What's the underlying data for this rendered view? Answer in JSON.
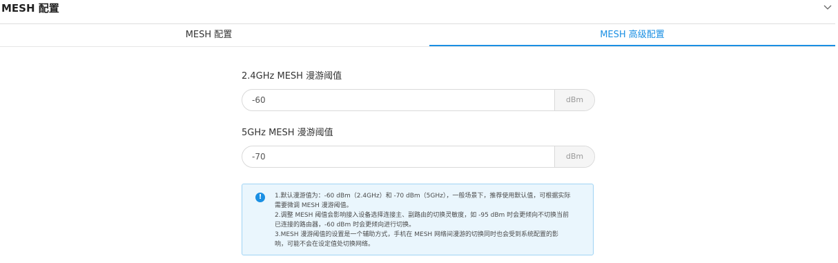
{
  "header": {
    "title": "MESH 配置",
    "collapse_icon": "chevron-down-icon"
  },
  "tabs": [
    {
      "label": "MESH 配置",
      "active": false
    },
    {
      "label": "MESH 高级配置",
      "active": true
    }
  ],
  "colors": {
    "accent": "#1a8fe3",
    "notice_bg": "#eaf6fd",
    "notice_border": "#9fd3f4"
  },
  "form": {
    "fields": [
      {
        "label": "2.4GHz MESH 漫游阈值",
        "value": "-60",
        "unit": "dBm"
      },
      {
        "label": "5GHz MESH 漫游阈值",
        "value": "-70",
        "unit": "dBm"
      }
    ]
  },
  "notice": {
    "icon": "info-icon",
    "lines": [
      "1.默认漫游值为：-60 dBm（2.4GHz）和 -70 dBm（5GHz），一般场景下，推荐使用默认值，可根据实际",
      "需要微调 MESH 漫游阈值。",
      "2.调整 MESH 阈值会影响接入设备选择连接主、副路由的切换灵敏度，如 -95 dBm 时会更倾向不切换当前",
      "已连接的路由器，-60 dBm 时会更倾向进行切换。",
      "3.MESH 漫游阈值的设置是一个辅助方式，手机在 MESH 网络间漫游的切换同时也会受到系统配置的影",
      "响，可能不会在设定值处切换网络。"
    ]
  }
}
